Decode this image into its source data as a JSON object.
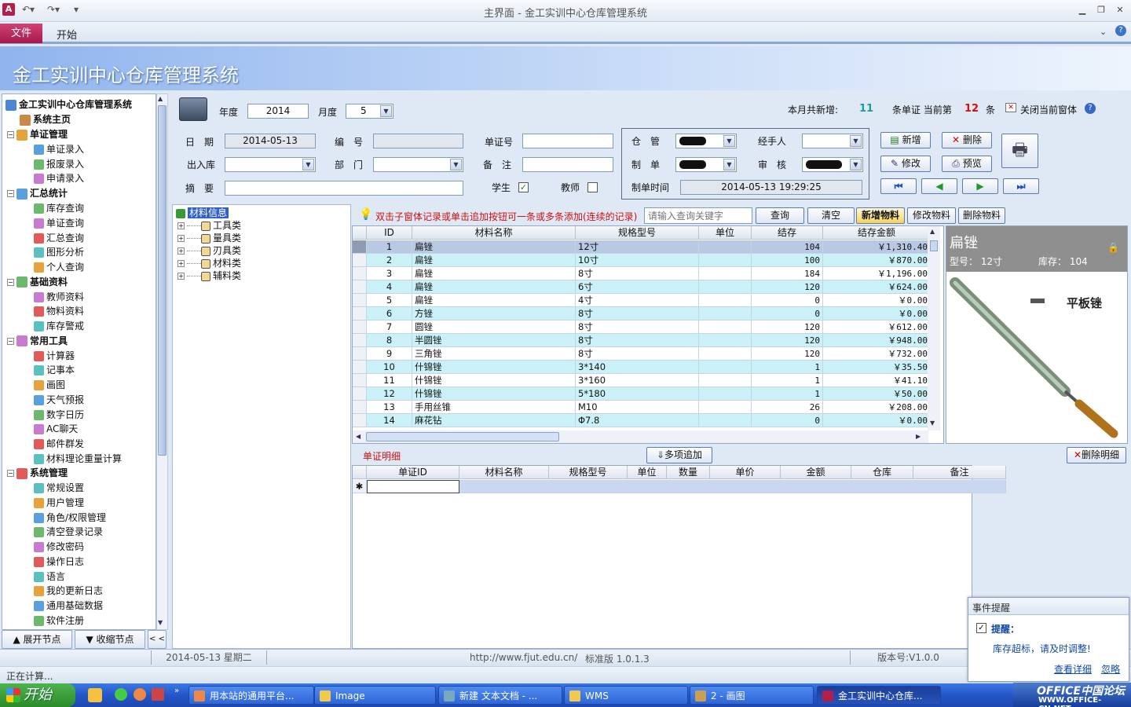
{
  "window": {
    "title": "主界面 - 金工实训中心仓库管理系统",
    "file_tab": "文件",
    "start_tab": "开始"
  },
  "banner": {
    "title": "金工实训中心仓库管理系统"
  },
  "nav": {
    "root": "金工实训中心仓库管理系统",
    "home": "系统主页",
    "groups": [
      {
        "label": "单证管理",
        "items": [
          "单证录入",
          "报废录入",
          "申请录入"
        ]
      },
      {
        "label": "汇总统计",
        "items": [
          "库存查询",
          "单证查询",
          "汇总查询",
          "图形分析",
          "个人查询"
        ]
      },
      {
        "label": "基础资料",
        "items": [
          "教师资料",
          "物料资料",
          "库存警戒"
        ]
      },
      {
        "label": "常用工具",
        "items": [
          "计算器",
          "记事本",
          "画图",
          "天气预报",
          "数字日历",
          "AC聊天",
          "邮件群发",
          "材料理论重量计算"
        ]
      },
      {
        "label": "系统管理",
        "items": [
          "常规设置",
          "用户管理",
          "角色/权限管理",
          "清空登录记录",
          "修改密码",
          "操作日志",
          "语言",
          "我的更新日志",
          "通用基础数据",
          "软件注册"
        ]
      }
    ],
    "expand_btn": "展开节点",
    "collapse_btn": "收缩节点",
    "side_btn": "< <"
  },
  "form": {
    "year_label": "年度",
    "year": "2014",
    "month_label": "月度",
    "month": "5",
    "summary_prefix": "本月共新增:",
    "summary_count": "11",
    "summary_mid": "条单证 当前第",
    "summary_current": "12",
    "summary_suffix": "条",
    "close_label": "关闭当前窗体",
    "date_label": "日　期",
    "date": "2014-05-13",
    "code_label": "编　号",
    "voucher_label": "单证号",
    "io_label": "出入库",
    "dept_label": "部　门",
    "remark_label": "备　注",
    "summary_field_label": "摘　要",
    "student_label": "学生",
    "teacher_label": "教师",
    "warehouse_label": "仓　管",
    "handler_label": "经手人",
    "maker_label": "制　单",
    "auditor_label": "审　核",
    "maketime_label": "制单时间",
    "maketime": "2014-05-13 19:29:25",
    "btn_add": "新增",
    "btn_delete": "删除",
    "btn_modify": "修改",
    "btn_preview": "预览"
  },
  "tree": {
    "root": "材料信息",
    "items": [
      "工具类",
      "量具类",
      "刃具类",
      "材料类",
      "辅料类"
    ]
  },
  "toolbar": {
    "tip": "双击子窗体记录或单击追加按钮可一条或多条添加(连续的记录)",
    "search_placeholder": "请输入查询关键字",
    "query": "查询",
    "clear": "清空",
    "add_material": "新增物料",
    "edit_material": "修改物料",
    "delete_material": "删除物料"
  },
  "grid": {
    "columns": [
      "ID",
      "材料名称",
      "规格型号",
      "单位",
      "结存",
      "结存金额"
    ],
    "rows": [
      [
        "1",
        "扁锉",
        "12寸",
        "",
        "104",
        "￥1,310.40"
      ],
      [
        "2",
        "扁锉",
        "10寸",
        "",
        "100",
        "￥870.00"
      ],
      [
        "3",
        "扁锉",
        "8寸",
        "",
        "184",
        "￥1,196.00"
      ],
      [
        "4",
        "扁锉",
        "6寸",
        "",
        "120",
        "￥624.00"
      ],
      [
        "5",
        "扁锉",
        "4寸",
        "",
        "0",
        "￥0.00"
      ],
      [
        "6",
        "方锉",
        "8寸",
        "",
        "0",
        "￥0.00"
      ],
      [
        "7",
        "圆锉",
        "8寸",
        "",
        "120",
        "￥612.00"
      ],
      [
        "8",
        "半圆锉",
        "8寸",
        "",
        "120",
        "￥948.00"
      ],
      [
        "9",
        "三角锉",
        "8寸",
        "",
        "120",
        "￥732.00"
      ],
      [
        "10",
        "什锦锉",
        "3*140",
        "",
        "1",
        "￥35.50"
      ],
      [
        "11",
        "什锦锉",
        "3*160",
        "",
        "1",
        "￥41.10"
      ],
      [
        "12",
        "什锦锉",
        "5*180",
        "",
        "1",
        "￥50.00"
      ],
      [
        "13",
        "手用丝锥",
        "M10",
        "",
        "26",
        "￥208.00"
      ],
      [
        "14",
        "麻花钻",
        "Φ7.8",
        "",
        "0",
        "￥0.00"
      ]
    ]
  },
  "detail": {
    "name": "扁锉",
    "model_label": "型号：",
    "model": "12寸",
    "stock_label": "库存：",
    "stock": "104",
    "image_caption": "平板锉"
  },
  "subgrid": {
    "title": "单证明细",
    "add_multi": "多项追加",
    "delete_detail": "删除明细",
    "columns": [
      "单证ID",
      "材料名称",
      "规格型号",
      "单位",
      "数量",
      "单价",
      "金额",
      "仓库",
      "备注"
    ],
    "new_row_marker": "✱"
  },
  "status": {
    "date": "2014-05-13 星期二",
    "url": "http://www.fjut.edu.cn/",
    "edition": "标准版 1.0.1.3",
    "version": "版本号:V1.0.0",
    "computing": "正在计算..."
  },
  "notify": {
    "title": "事件提醒",
    "heading": "提醒：",
    "message": "库存超标，请及时调整!",
    "details": "查看详细",
    "ignore": "忽略"
  },
  "taskbar": {
    "start": "开始",
    "tasks": [
      "用本站的通用平台...",
      "Image",
      "新建 文本文档 - ...",
      "WMS",
      "2 - 画图",
      "金工实训中心仓库..."
    ],
    "watermark": "OFFICE中国论坛",
    "watermark_url": "WWW.OFFICE-CN.NET"
  },
  "colors": {
    "accent": "#b41e4a",
    "row_alt": "#c9f1f7",
    "red_text": "#d01010",
    "teal_count": "#1a9b9b"
  }
}
